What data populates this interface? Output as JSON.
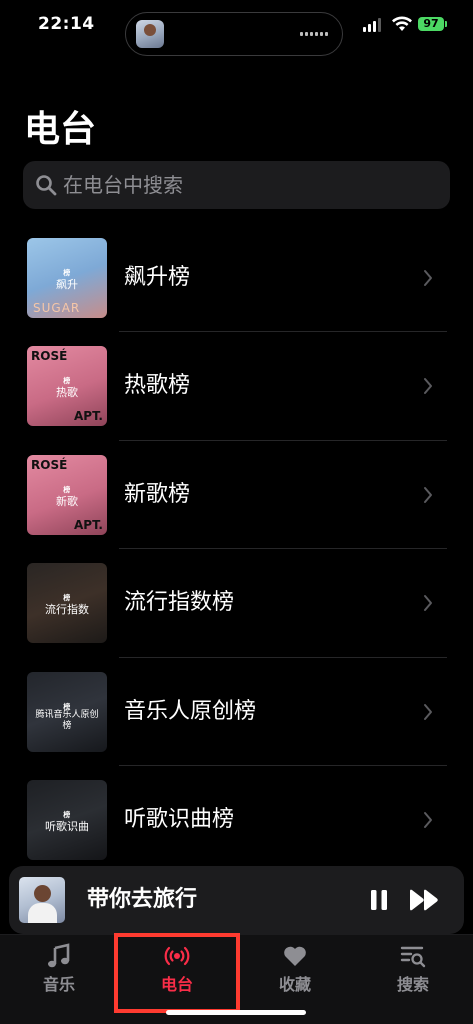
{
  "status": {
    "time": "22:14",
    "battery": "97"
  },
  "page": {
    "title": "电台",
    "search_placeholder": "在电台中搜索"
  },
  "charts": [
    {
      "label": "飙升榜",
      "cover_text": "飙升",
      "cover_style": "sugar"
    },
    {
      "label": "热歌榜",
      "cover_text": "热歌",
      "cover_style": "rose"
    },
    {
      "label": "新歌榜",
      "cover_text": "新歌",
      "cover_style": "rose"
    },
    {
      "label": "流行指数榜",
      "cover_text": "流行指数",
      "cover_style": "dark"
    },
    {
      "label": "音乐人原创榜",
      "cover_text": "腾讯音乐人原创榜",
      "cover_style": "dark"
    },
    {
      "label": "听歌识曲榜",
      "cover_text": "听歌识曲",
      "cover_style": "dark"
    }
  ],
  "cover_brand": "榜",
  "rose_cover": {
    "top": "ROSÉ",
    "bottom": "APT."
  },
  "sugar_cover": {
    "bottom": "SUGAR"
  },
  "now_playing": {
    "title": "带你去旅行"
  },
  "tabs": [
    {
      "label": "音乐",
      "icon": "music-note-icon",
      "active": false
    },
    {
      "label": "电台",
      "icon": "radio-broadcast-icon",
      "active": true
    },
    {
      "label": "收藏",
      "icon": "heart-icon",
      "active": false
    },
    {
      "label": "搜索",
      "icon": "search-list-icon",
      "active": false
    }
  ],
  "colors": {
    "accent": "#fa2d48",
    "background": "#000000",
    "highlight_box": "#ff3b30",
    "battery": "#4cd964"
  }
}
